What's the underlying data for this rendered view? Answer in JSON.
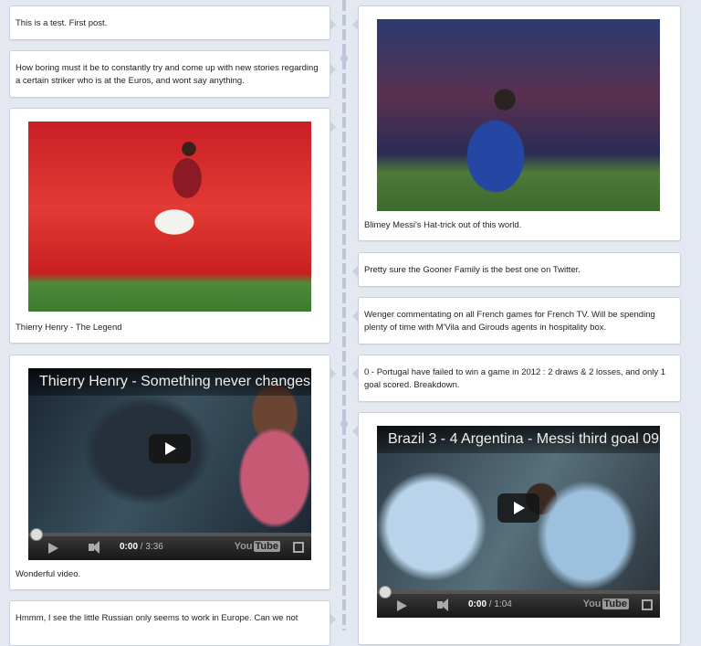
{
  "posts_left": [
    {
      "text": "This is a test. First post."
    },
    {
      "text": "How boring must it be to constantly try and come up with new stories regarding a certain striker who is at the Euros, and wont say anything."
    },
    {
      "text": "Thierry Henry - The Legend",
      "image_icon": "photo-henry"
    },
    {
      "text": "Wonderful video.",
      "video": {
        "title": "Thierry Henry - Something never changes",
        "current_time": "0:00",
        "duration": "3:36",
        "progress": 0
      }
    },
    {
      "text": "Hmmm, I see the little Russian only seems to work in Europe. Can we not"
    }
  ],
  "posts_right": [
    {
      "text": "Blimey Messi's Hat-trick out of this world.",
      "image_icon": "photo-messi"
    },
    {
      "text": "Pretty sure the Gooner Family is the best one on Twitter."
    },
    {
      "text": "Wenger commentating on all French games for French TV. Will be spending plenty of time with M'Vila and Girouds agents in hospitality box."
    },
    {
      "text": "0 - Portugal have failed to win a game in 2012 : 2 draws & 2 losses, and only 1 goal scored. Breakdown."
    },
    {
      "text": "",
      "video": {
        "title": "Brazil 3 - 4 Argentina - Messi third goal 09",
        "current_time": "0:00",
        "duration": "1:04",
        "progress": 0
      }
    }
  ],
  "player": {
    "time_separator": " / ",
    "brand_you": "You",
    "brand_tube": "Tube"
  },
  "colors": {
    "background": "#e4e8f1",
    "card_border": "#c9d0df",
    "timeline": "#bcc6da"
  }
}
